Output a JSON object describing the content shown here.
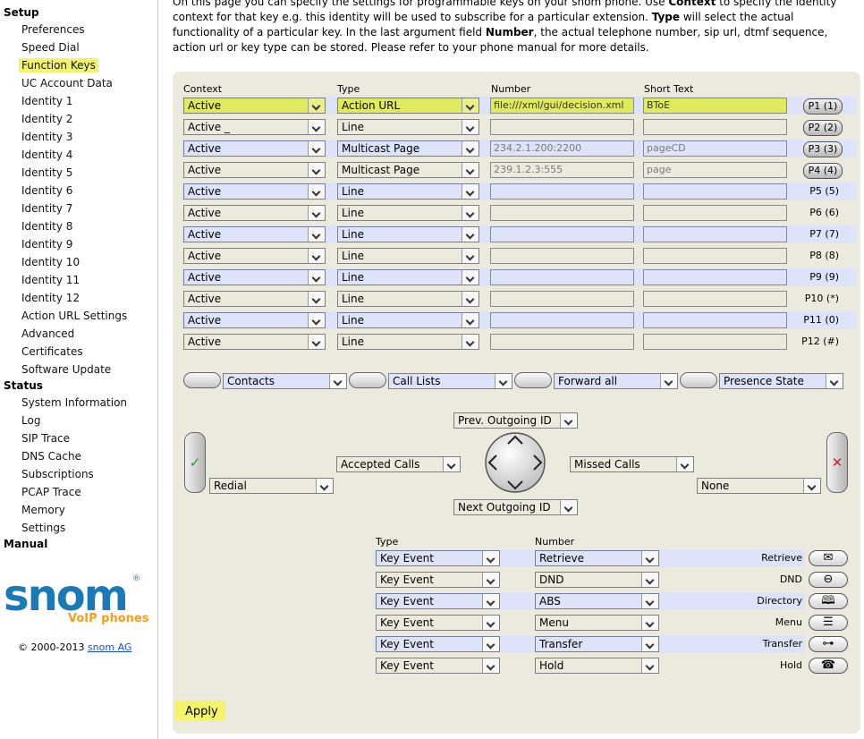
{
  "sidebar": {
    "setup_title": "Setup",
    "setup_items": [
      "Preferences",
      "Speed Dial",
      "Function Keys",
      "UC Account Data",
      "Identity 1",
      "Identity 2",
      "Identity 3",
      "Identity 4",
      "Identity 5",
      "Identity 6",
      "Identity 7",
      "Identity 8",
      "Identity 9",
      "Identity 10",
      "Identity 11",
      "Identity 12",
      "Action URL Settings",
      "Advanced",
      "Certificates",
      "Software Update"
    ],
    "active_item": "Function Keys",
    "status_title": "Status",
    "status_items": [
      "System Information",
      "Log",
      "SIP Trace",
      "DNS Cache",
      "Subscriptions",
      "PCAP Trace",
      "Memory",
      "Settings"
    ],
    "manual_title": "Manual",
    "logo": {
      "word": "snom",
      "sub": "VoIP phones",
      "reg": "®"
    },
    "copyright_text": "© 2000-2013 ",
    "copyright_link": "snom AG"
  },
  "intro": {
    "p1": "On this page you can specify the settings for programmable keys on your snom phone. Use ",
    "b1": "Context",
    "p2": " to specify the identity context for that key e.g. this identity will be used to subscribe for a particular extension. ",
    "b2": "Type",
    "p3": " will select the actual functionality of a particular key. In the last argument field ",
    "b3": "Number",
    "p4": ", the actual telephone number, sip url, dtmf sequence, action url or key type can be stored. Please refer to your phone manual for more details."
  },
  "headers": {
    "context": "Context",
    "type": "Type",
    "number": "Number",
    "short_text": "Short Text"
  },
  "pkeys": [
    {
      "context": "Active",
      "type": "Action URL",
      "number": "file:///xml/gui/decision.xml",
      "short": "BToE",
      "label": "P1 (1)",
      "button": true
    },
    {
      "context": "Active _",
      "type": "Line",
      "number": "",
      "short": "",
      "label": "P2 (2)",
      "button": true
    },
    {
      "context": "Active",
      "type": "Multicast Page",
      "number": "234.2.1.200:2200",
      "short": "pageCD",
      "label": "P3 (3)",
      "button": true
    },
    {
      "context": "Active",
      "type": "Multicast Page",
      "number": "239.1.2.3:555",
      "short": "page",
      "label": "P4 (4)",
      "button": true
    },
    {
      "context": "Active",
      "type": "Line",
      "number": "",
      "short": "",
      "label": "P5 (5)",
      "button": false
    },
    {
      "context": "Active",
      "type": "Line",
      "number": "",
      "short": "",
      "label": "P6 (6)",
      "button": false
    },
    {
      "context": "Active",
      "type": "Line",
      "number": "",
      "short": "",
      "label": "P7 (7)",
      "button": false
    },
    {
      "context": "Active",
      "type": "Line",
      "number": "",
      "short": "",
      "label": "P8 (8)",
      "button": false
    },
    {
      "context": "Active",
      "type": "Line",
      "number": "",
      "short": "",
      "label": "P9 (9)",
      "button": false
    },
    {
      "context": "Active",
      "type": "Line",
      "number": "",
      "short": "",
      "label": "P10 (*)",
      "button": false
    },
    {
      "context": "Active",
      "type": "Line",
      "number": "",
      "short": "",
      "label": "P11 (0)",
      "button": false
    },
    {
      "context": "Active",
      "type": "Line",
      "number": "",
      "short": "",
      "label": "P12 (#)",
      "button": false
    }
  ],
  "softkeys": [
    "Contacts",
    "Call Lists",
    "Forward all",
    "Presence State"
  ],
  "nav": {
    "up": "Prev. Outgoing ID",
    "down": "Next Outgoing ID",
    "left": "Accepted Calls",
    "right": "Missed Calls",
    "green": "Redial",
    "red": "None"
  },
  "fixed_headers": {
    "type": "Type",
    "number": "Number"
  },
  "fixed_keys": [
    {
      "type": "Key Event",
      "number": "Retrieve",
      "label": "Retrieve",
      "icon": "envelope-icon"
    },
    {
      "type": "Key Event",
      "number": "DND",
      "label": "DND",
      "icon": "dnd-icon"
    },
    {
      "type": "Key Event",
      "number": "ABS",
      "label": "Directory",
      "icon": "book-icon"
    },
    {
      "type": "Key Event",
      "number": "Menu",
      "label": "Menu",
      "icon": "menu-icon"
    },
    {
      "type": "Key Event",
      "number": "Transfer",
      "label": "Transfer",
      "icon": "transfer-icon"
    },
    {
      "type": "Key Event",
      "number": "Hold",
      "label": "Hold",
      "icon": "hold-icon"
    }
  ],
  "apply_label": "Apply",
  "colors": {
    "highlight": "#f4f46a",
    "panel": "#eceadc",
    "field_blue": "#dde3f8",
    "logo_blue": "#1a7ab8",
    "logo_orange": "#f5a01a"
  }
}
